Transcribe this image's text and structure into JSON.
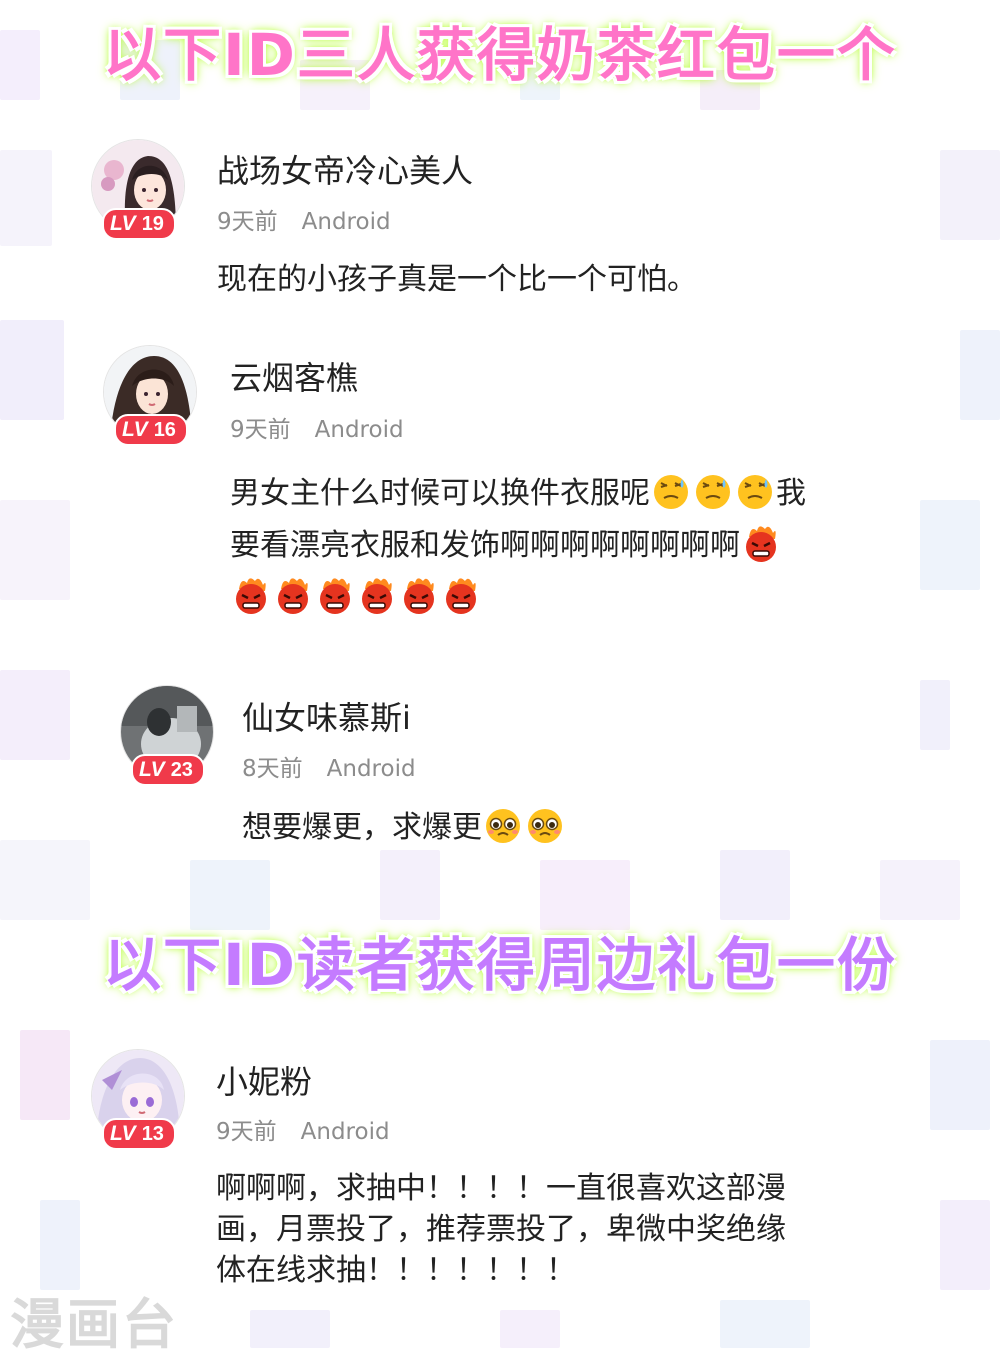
{
  "banners": {
    "top": "以下ID三人获得奶茶红包一个",
    "middle": "以下ID读者获得周边礼包一份"
  },
  "colors": {
    "banner_top": "#ff74c8",
    "banner_middle": "#c47bff",
    "glow": "#b8ff3a",
    "level_badge": "#f03a4a",
    "meta_text": "#8c8c8c"
  },
  "comments": [
    {
      "username": "战场女帝冷心美人",
      "level_prefix": "LV",
      "level": "19",
      "time": "9天前",
      "platform": "Android",
      "lines": [
        "现在的小孩子真是一个比一个可怕。"
      ]
    },
    {
      "username": "云烟客樵",
      "level_prefix": "LV",
      "level": "16",
      "time": "9天前",
      "platform": "Android",
      "line1_text": "男女主什么时候可以换件衣服呢",
      "line1_tail": "我",
      "line2_text": "要看漂亮衣服和发饰啊啊啊啊啊啊啊啊",
      "emojis": [
        "sweat-emoji",
        "angry-fire-emoji"
      ]
    },
    {
      "username": "仙女味慕斯i",
      "level_prefix": "LV",
      "level": "23",
      "time": "8天前",
      "platform": "Android",
      "text": "想要爆更，求爆更",
      "emojis": [
        "pleading-emoji"
      ]
    },
    {
      "username": "小妮粉",
      "level_prefix": "LV",
      "level": "13",
      "time": "9天前",
      "platform": "Android",
      "lines": [
        "啊啊啊，求抽中！！！！一直很喜欢这部漫",
        "画，月票投了，推荐票投了，卑微中奖绝缘",
        "体在线求抽！！！！！！！"
      ]
    }
  ],
  "watermark": "漫画台"
}
